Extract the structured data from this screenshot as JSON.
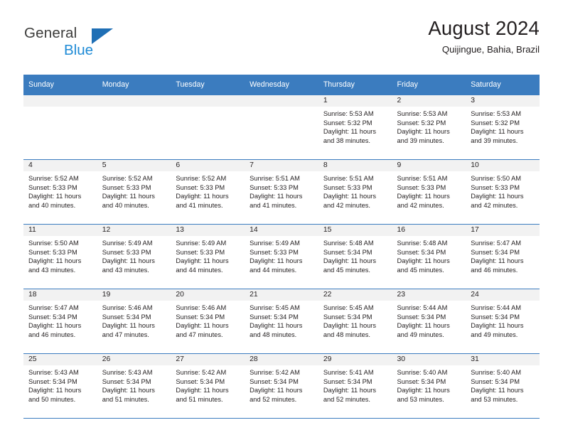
{
  "brand": {
    "name_top": "General",
    "name_bottom": "Blue",
    "triangle_color": "#1f6fb5",
    "blue_color": "#1f8bd6"
  },
  "header": {
    "title": "August 2024",
    "subtitle": "Quijingue, Bahia, Brazil"
  },
  "theme": {
    "header_bg": "#3b7cbf",
    "header_text": "#ffffff",
    "daynum_bg": "#f2f2f2",
    "row_border": "#3b7cbf",
    "body_text": "#231f20"
  },
  "weekdays": [
    "Sunday",
    "Monday",
    "Tuesday",
    "Wednesday",
    "Thursday",
    "Friday",
    "Saturday"
  ],
  "labels": {
    "sunrise_prefix": "Sunrise:",
    "sunset_prefix": "Sunset:",
    "daylight_prefix": "Daylight:"
  },
  "weeks": [
    [
      {
        "day": ""
      },
      {
        "day": ""
      },
      {
        "day": ""
      },
      {
        "day": ""
      },
      {
        "day": "1",
        "sunrise": "Sunrise: 5:53 AM",
        "sunset": "Sunset: 5:32 PM",
        "daylight": "Daylight: 11 hours and 38 minutes."
      },
      {
        "day": "2",
        "sunrise": "Sunrise: 5:53 AM",
        "sunset": "Sunset: 5:32 PM",
        "daylight": "Daylight: 11 hours and 39 minutes."
      },
      {
        "day": "3",
        "sunrise": "Sunrise: 5:53 AM",
        "sunset": "Sunset: 5:32 PM",
        "daylight": "Daylight: 11 hours and 39 minutes."
      }
    ],
    [
      {
        "day": "4",
        "sunrise": "Sunrise: 5:52 AM",
        "sunset": "Sunset: 5:33 PM",
        "daylight": "Daylight: 11 hours and 40 minutes."
      },
      {
        "day": "5",
        "sunrise": "Sunrise: 5:52 AM",
        "sunset": "Sunset: 5:33 PM",
        "daylight": "Daylight: 11 hours and 40 minutes."
      },
      {
        "day": "6",
        "sunrise": "Sunrise: 5:52 AM",
        "sunset": "Sunset: 5:33 PM",
        "daylight": "Daylight: 11 hours and 41 minutes."
      },
      {
        "day": "7",
        "sunrise": "Sunrise: 5:51 AM",
        "sunset": "Sunset: 5:33 PM",
        "daylight": "Daylight: 11 hours and 41 minutes."
      },
      {
        "day": "8",
        "sunrise": "Sunrise: 5:51 AM",
        "sunset": "Sunset: 5:33 PM",
        "daylight": "Daylight: 11 hours and 42 minutes."
      },
      {
        "day": "9",
        "sunrise": "Sunrise: 5:51 AM",
        "sunset": "Sunset: 5:33 PM",
        "daylight": "Daylight: 11 hours and 42 minutes."
      },
      {
        "day": "10",
        "sunrise": "Sunrise: 5:50 AM",
        "sunset": "Sunset: 5:33 PM",
        "daylight": "Daylight: 11 hours and 42 minutes."
      }
    ],
    [
      {
        "day": "11",
        "sunrise": "Sunrise: 5:50 AM",
        "sunset": "Sunset: 5:33 PM",
        "daylight": "Daylight: 11 hours and 43 minutes."
      },
      {
        "day": "12",
        "sunrise": "Sunrise: 5:49 AM",
        "sunset": "Sunset: 5:33 PM",
        "daylight": "Daylight: 11 hours and 43 minutes."
      },
      {
        "day": "13",
        "sunrise": "Sunrise: 5:49 AM",
        "sunset": "Sunset: 5:33 PM",
        "daylight": "Daylight: 11 hours and 44 minutes."
      },
      {
        "day": "14",
        "sunrise": "Sunrise: 5:49 AM",
        "sunset": "Sunset: 5:33 PM",
        "daylight": "Daylight: 11 hours and 44 minutes."
      },
      {
        "day": "15",
        "sunrise": "Sunrise: 5:48 AM",
        "sunset": "Sunset: 5:34 PM",
        "daylight": "Daylight: 11 hours and 45 minutes."
      },
      {
        "day": "16",
        "sunrise": "Sunrise: 5:48 AM",
        "sunset": "Sunset: 5:34 PM",
        "daylight": "Daylight: 11 hours and 45 minutes."
      },
      {
        "day": "17",
        "sunrise": "Sunrise: 5:47 AM",
        "sunset": "Sunset: 5:34 PM",
        "daylight": "Daylight: 11 hours and 46 minutes."
      }
    ],
    [
      {
        "day": "18",
        "sunrise": "Sunrise: 5:47 AM",
        "sunset": "Sunset: 5:34 PM",
        "daylight": "Daylight: 11 hours and 46 minutes."
      },
      {
        "day": "19",
        "sunrise": "Sunrise: 5:46 AM",
        "sunset": "Sunset: 5:34 PM",
        "daylight": "Daylight: 11 hours and 47 minutes."
      },
      {
        "day": "20",
        "sunrise": "Sunrise: 5:46 AM",
        "sunset": "Sunset: 5:34 PM",
        "daylight": "Daylight: 11 hours and 47 minutes."
      },
      {
        "day": "21",
        "sunrise": "Sunrise: 5:45 AM",
        "sunset": "Sunset: 5:34 PM",
        "daylight": "Daylight: 11 hours and 48 minutes."
      },
      {
        "day": "22",
        "sunrise": "Sunrise: 5:45 AM",
        "sunset": "Sunset: 5:34 PM",
        "daylight": "Daylight: 11 hours and 48 minutes."
      },
      {
        "day": "23",
        "sunrise": "Sunrise: 5:44 AM",
        "sunset": "Sunset: 5:34 PM",
        "daylight": "Daylight: 11 hours and 49 minutes."
      },
      {
        "day": "24",
        "sunrise": "Sunrise: 5:44 AM",
        "sunset": "Sunset: 5:34 PM",
        "daylight": "Daylight: 11 hours and 49 minutes."
      }
    ],
    [
      {
        "day": "25",
        "sunrise": "Sunrise: 5:43 AM",
        "sunset": "Sunset: 5:34 PM",
        "daylight": "Daylight: 11 hours and 50 minutes."
      },
      {
        "day": "26",
        "sunrise": "Sunrise: 5:43 AM",
        "sunset": "Sunset: 5:34 PM",
        "daylight": "Daylight: 11 hours and 51 minutes."
      },
      {
        "day": "27",
        "sunrise": "Sunrise: 5:42 AM",
        "sunset": "Sunset: 5:34 PM",
        "daylight": "Daylight: 11 hours and 51 minutes."
      },
      {
        "day": "28",
        "sunrise": "Sunrise: 5:42 AM",
        "sunset": "Sunset: 5:34 PM",
        "daylight": "Daylight: 11 hours and 52 minutes."
      },
      {
        "day": "29",
        "sunrise": "Sunrise: 5:41 AM",
        "sunset": "Sunset: 5:34 PM",
        "daylight": "Daylight: 11 hours and 52 minutes."
      },
      {
        "day": "30",
        "sunrise": "Sunrise: 5:40 AM",
        "sunset": "Sunset: 5:34 PM",
        "daylight": "Daylight: 11 hours and 53 minutes."
      },
      {
        "day": "31",
        "sunrise": "Sunrise: 5:40 AM",
        "sunset": "Sunset: 5:34 PM",
        "daylight": "Daylight: 11 hours and 53 minutes."
      }
    ]
  ]
}
